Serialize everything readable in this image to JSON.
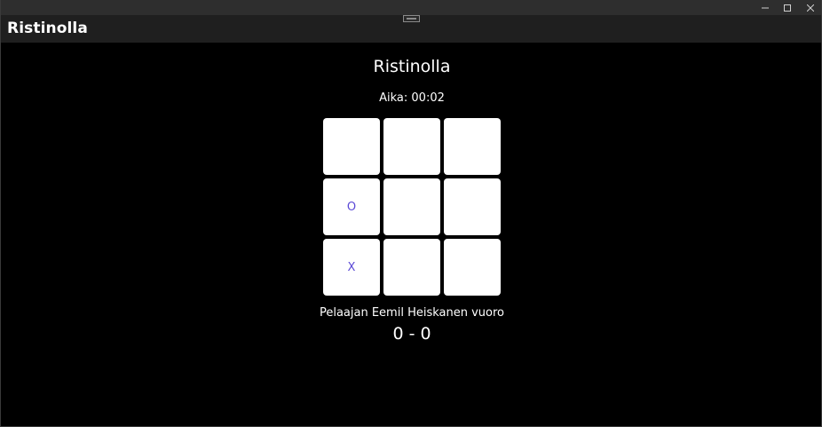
{
  "window": {
    "title": "Ristinolla"
  },
  "page": {
    "title": "Ristinolla",
    "timer_label": "Aika:",
    "timer_value": "00:02"
  },
  "board": {
    "cells": [
      "",
      "",
      "",
      "O",
      "",
      "",
      "X",
      "",
      ""
    ],
    "mark_color": "#5b49d6",
    "cell_color": "#ffffff"
  },
  "status": {
    "turn_text": "Pelaajan Eemil Heiskanen vuoro",
    "score": "0 - 0"
  },
  "icons": {
    "minimize": "minimize-icon",
    "maximize": "maximize-icon",
    "close": "close-icon",
    "dock_handle": "dock-handle-icon"
  }
}
